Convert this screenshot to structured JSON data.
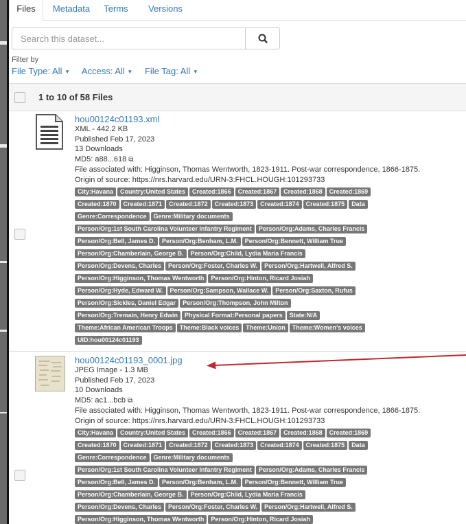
{
  "tabs": [
    "Files",
    "Metadata",
    "Terms",
    "Versions"
  ],
  "search": {
    "placeholder": "Search this dataset...",
    "button_icon": "search-icon"
  },
  "filter_label": "Filter by",
  "filters": [
    "File Type: All",
    "Access: All",
    "File Tag: All"
  ],
  "table_header": "1 to 10 of 58 Files",
  "files": [
    {
      "name": "hou00124c01193.xml",
      "type_size": "XML - 442.2 KB",
      "published": "Published Feb 17, 2023",
      "downloads": "13 Downloads",
      "md5": "MD5: a88...618",
      "associated": "File associated with: Higginson, Thomas Wentworth, 1823-1911. Post-war correspondence, 1866-1875.",
      "origin": "Origin of source: https://nrs.harvard.edu/URN-3:FHCL.HOUGH:101293733",
      "thumb_icon": "document-icon",
      "tag_lines": [
        [
          "City:Havana",
          "Country:United States",
          "Created:1866",
          "Created:1867",
          "Created:1868",
          "Created:1869"
        ],
        [
          "Created:1870",
          "Created:1871",
          "Created:1872",
          "Created:1873",
          "Created:1874",
          "Created:1875",
          "Data"
        ],
        [
          "Genre:Correspondence",
          "Genre:Military documents"
        ],
        [
          "Person/Org:1st South Carolina Volunteer Infantry Regiment",
          "Person/Org:Adams, Charles Francis"
        ],
        [
          "Person/Org:Bell, James D.",
          "Person/Org:Benham, L.M.",
          "Person/Org:Bennett, William True"
        ],
        [
          "Person/Org:Chamberlain, George B.",
          "Person/Org:Child, Lydia Maria Francis"
        ],
        [
          "Person/Org:Devens, Charles",
          "Person/Org:Foster, Charles W.",
          "Person/Org:Hartwell, Alfred S."
        ],
        [
          "Person/Org:Higginson, Thomas Wentworth",
          "Person/Org:Hinton, Ricard Josiah"
        ],
        [
          "Person/Org:Hyde, Edward W.",
          "Person/Org:Sampson, Wallace W.",
          "Person/Org:Saxton, Rufus"
        ],
        [
          "Person/Org:Sickles, Daniel Edgar",
          "Person/Org:Thompson, John Milton"
        ],
        [
          "Person/Org:Tremain, Henry Edwin",
          "Physical Format:Personal papers",
          "State:N/A"
        ],
        [
          "Theme:African American Troops",
          "Theme:Black voices",
          "Theme:Union",
          "Theme:Women's voices"
        ],
        [
          "UID:hou00124c01193"
        ]
      ]
    },
    {
      "name": "hou00124c01193_0001.jpg",
      "type_size": "JPEG Image - 1.3 MB",
      "published": "Published Feb 17, 2023",
      "downloads": "10 Downloads",
      "md5": "MD5: ac1...bcb",
      "associated": "File associated with: Higginson, Thomas Wentworth, 1823-1911. Post-war correspondence, 1866-1875.",
      "origin": "Origin of source: https://nrs.harvard.edu/URN-3:FHCL.HOUGH:101293733",
      "thumb_icon": "manuscript-thumbnail",
      "tag_lines": [
        [
          "City:Havana",
          "Country:United States",
          "Created:1866",
          "Created:1867",
          "Created:1868",
          "Created:1869"
        ],
        [
          "Created:1870",
          "Created:1871",
          "Created:1872",
          "Created:1873",
          "Created:1874",
          "Created:1875",
          "Data"
        ],
        [
          "Genre:Correspondence",
          "Genre:Military documents"
        ],
        [
          "Person/Org:1st South Carolina Volunteer Infantry Regiment",
          "Person/Org:Adams, Charles Francis"
        ],
        [
          "Person/Org:Bell, James D.",
          "Person/Org:Benham, L.M.",
          "Person/Org:Bennett, William True"
        ],
        [
          "Person/Org:Chamberlain, George B.",
          "Person/Org:Child, Lydia Maria Francis"
        ],
        [
          "Person/Org:Devens, Charles",
          "Person/Org:Foster, Charles W.",
          "Person/Org:Hartwell, Alfred S."
        ],
        [
          "Person/Org:Higginson, Thomas Wentworth",
          "Person/Org:Hinton, Ricard Josiah"
        ]
      ]
    }
  ],
  "colors": {
    "link": "#337ab7",
    "tag_bg": "#777777",
    "arrow": "#c0282d"
  }
}
